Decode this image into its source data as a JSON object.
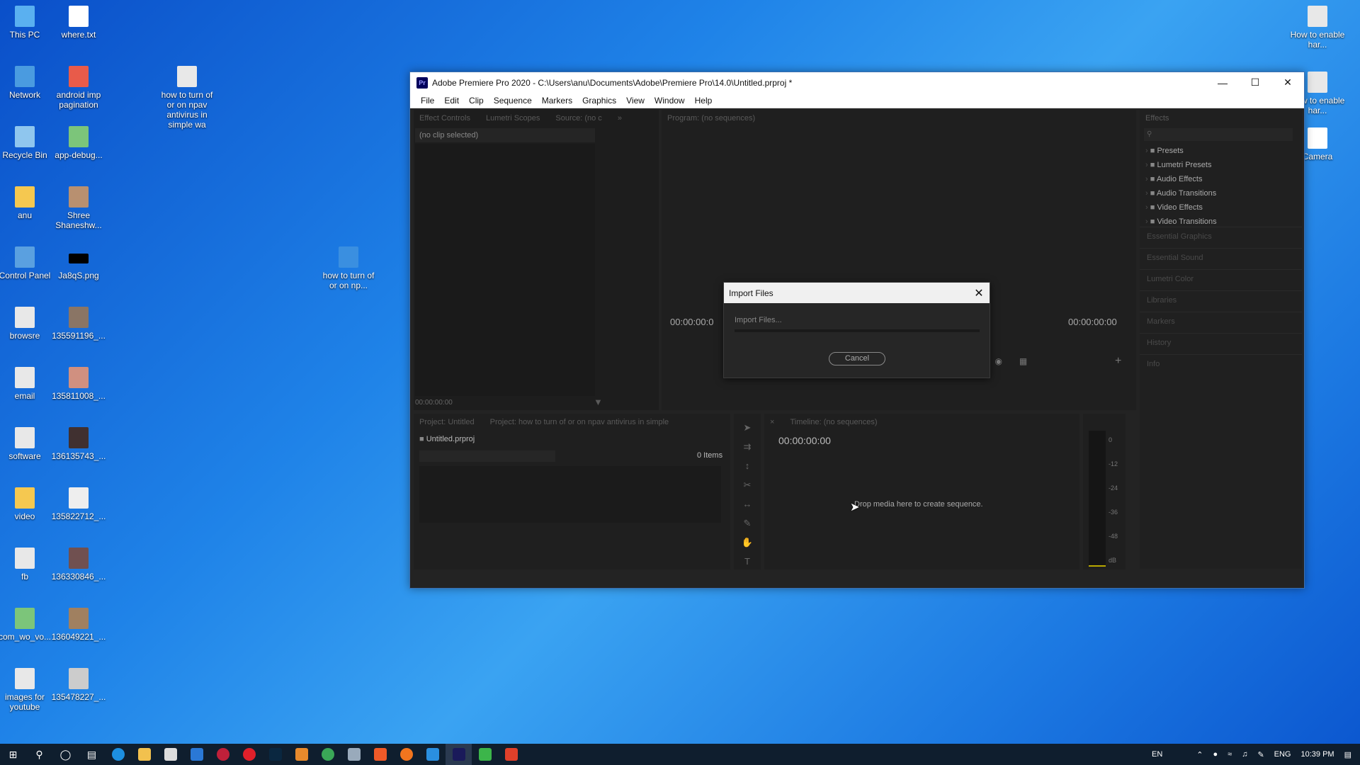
{
  "desktop": {
    "icons_col1": [
      "This PC",
      "Network",
      "Recycle Bin",
      "anu",
      "Control Panel",
      "browsre",
      "email",
      "software",
      "video",
      "fb",
      "com_wo_vo...",
      "images for youtube"
    ],
    "icons_col2": [
      "where.txt",
      "android imp pagination",
      "app-debug...",
      "Shree Shaneshw...",
      "Ja8qS.png",
      "135591196_...",
      "135811008_...",
      "136135743_...",
      "135822712_...",
      "136330846_...",
      "136049221_...",
      "135478227_..."
    ],
    "icon_mid1": "how to turn of or on npav antivirus in simple wa",
    "icon_mid2": "how to turn of or on np...",
    "icon_right1": "How to enable har...",
    "icon_right2": "How to enable har...",
    "icon_right3": "Camera"
  },
  "window": {
    "title": "Adobe Premiere Pro 2020 - C:\\Users\\anu\\Documents\\Adobe\\Premiere Pro\\14.0\\Untitled.prproj *",
    "icon_label": "Pr",
    "menu": [
      "File",
      "Edit",
      "Clip",
      "Sequence",
      "Markers",
      "Graphics",
      "View",
      "Window",
      "Help"
    ]
  },
  "effect_controls": {
    "tabs": [
      "Effect Controls",
      "Lumetri Scopes",
      "Source: (no c"
    ],
    "clip_label": "(no clip selected)",
    "timecode": "00:00:00:00"
  },
  "program": {
    "tab": "Program: (no sequences)",
    "tc_left": "00:00:00:0",
    "tc_right": "00:00:00:00"
  },
  "effects": {
    "tab": "Effects",
    "items": [
      "Presets",
      "Lumetri Presets",
      "Audio Effects",
      "Audio Transitions",
      "Video Effects",
      "Video Transitions"
    ],
    "side_panels": [
      "Essential Graphics",
      "Essential Sound",
      "Lumetri Color",
      "Libraries",
      "Markers",
      "History",
      "Info"
    ]
  },
  "project": {
    "tabs": [
      "Project: Untitled",
      "Project: how to turn of or on npav antivirus in simple"
    ],
    "file": "Untitled.prproj",
    "count": "0 Items"
  },
  "timeline": {
    "tab": "Timeline: (no sequences)",
    "timecode": "00:00:00:00",
    "drop_text": "Drop media here to create sequence.",
    "meter_labels": [
      "0",
      "-12",
      "-24",
      "-36",
      "-48",
      "dB"
    ]
  },
  "dialog": {
    "title": "Import Files",
    "status": "Import Files...",
    "cancel": "Cancel"
  },
  "taskbar": {
    "lang": "EN",
    "lang2": "ENG",
    "time": "10:39 PM"
  }
}
